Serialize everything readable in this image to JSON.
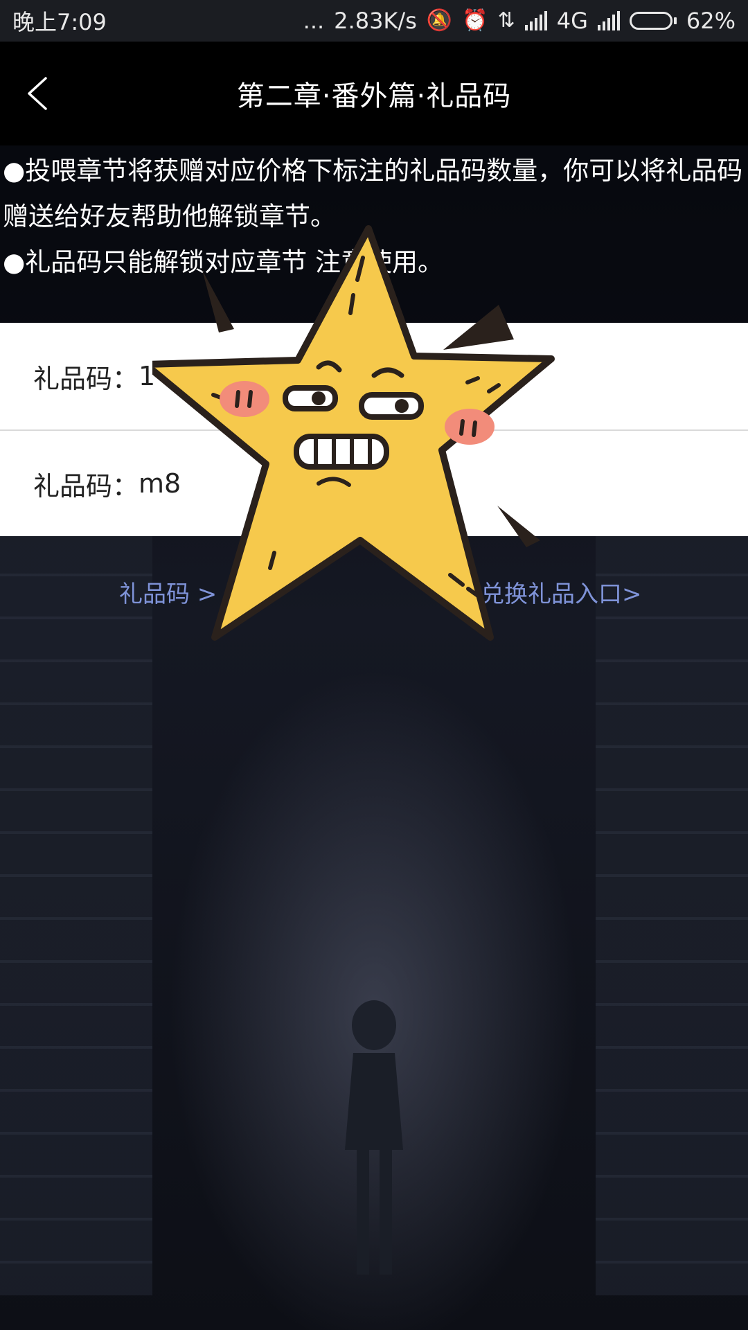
{
  "status_bar": {
    "time": "晚上7:09",
    "dots": "...",
    "speed": "2.83K/s",
    "network": "4G",
    "battery": "62%",
    "battery_level": 0.62,
    "icons": [
      "mute-icon",
      "alarm-icon",
      "data-arrows-icon",
      "signal-icon",
      "signal-icon",
      "battery-icon"
    ]
  },
  "header": {
    "title": "第二章·番外篇·礼品码",
    "back_icon": "chevron-left-icon"
  },
  "notes": [
    "●投喂章节将获赠对应价格下标注的礼品码数量，你可以将礼品码赠送给好友帮助他解锁章节。",
    "●礼品码只能解锁对应章节 注意使用。"
  ],
  "codes": [
    {
      "label": "礼品码：",
      "value": "1"
    },
    {
      "label": "礼品码：",
      "value": "m8"
    }
  ],
  "links": {
    "left": "礼品码 >",
    "right": "兑换礼品入口>"
  },
  "sticker": {
    "name": "star-sticker",
    "colors": {
      "fill": "#F6C94C",
      "outline": "#2a211c",
      "blush": "#F28C7A"
    }
  },
  "colors": {
    "header_bg": "#000000",
    "link": "#7f93d8",
    "status_bg": "#1b1d22"
  }
}
